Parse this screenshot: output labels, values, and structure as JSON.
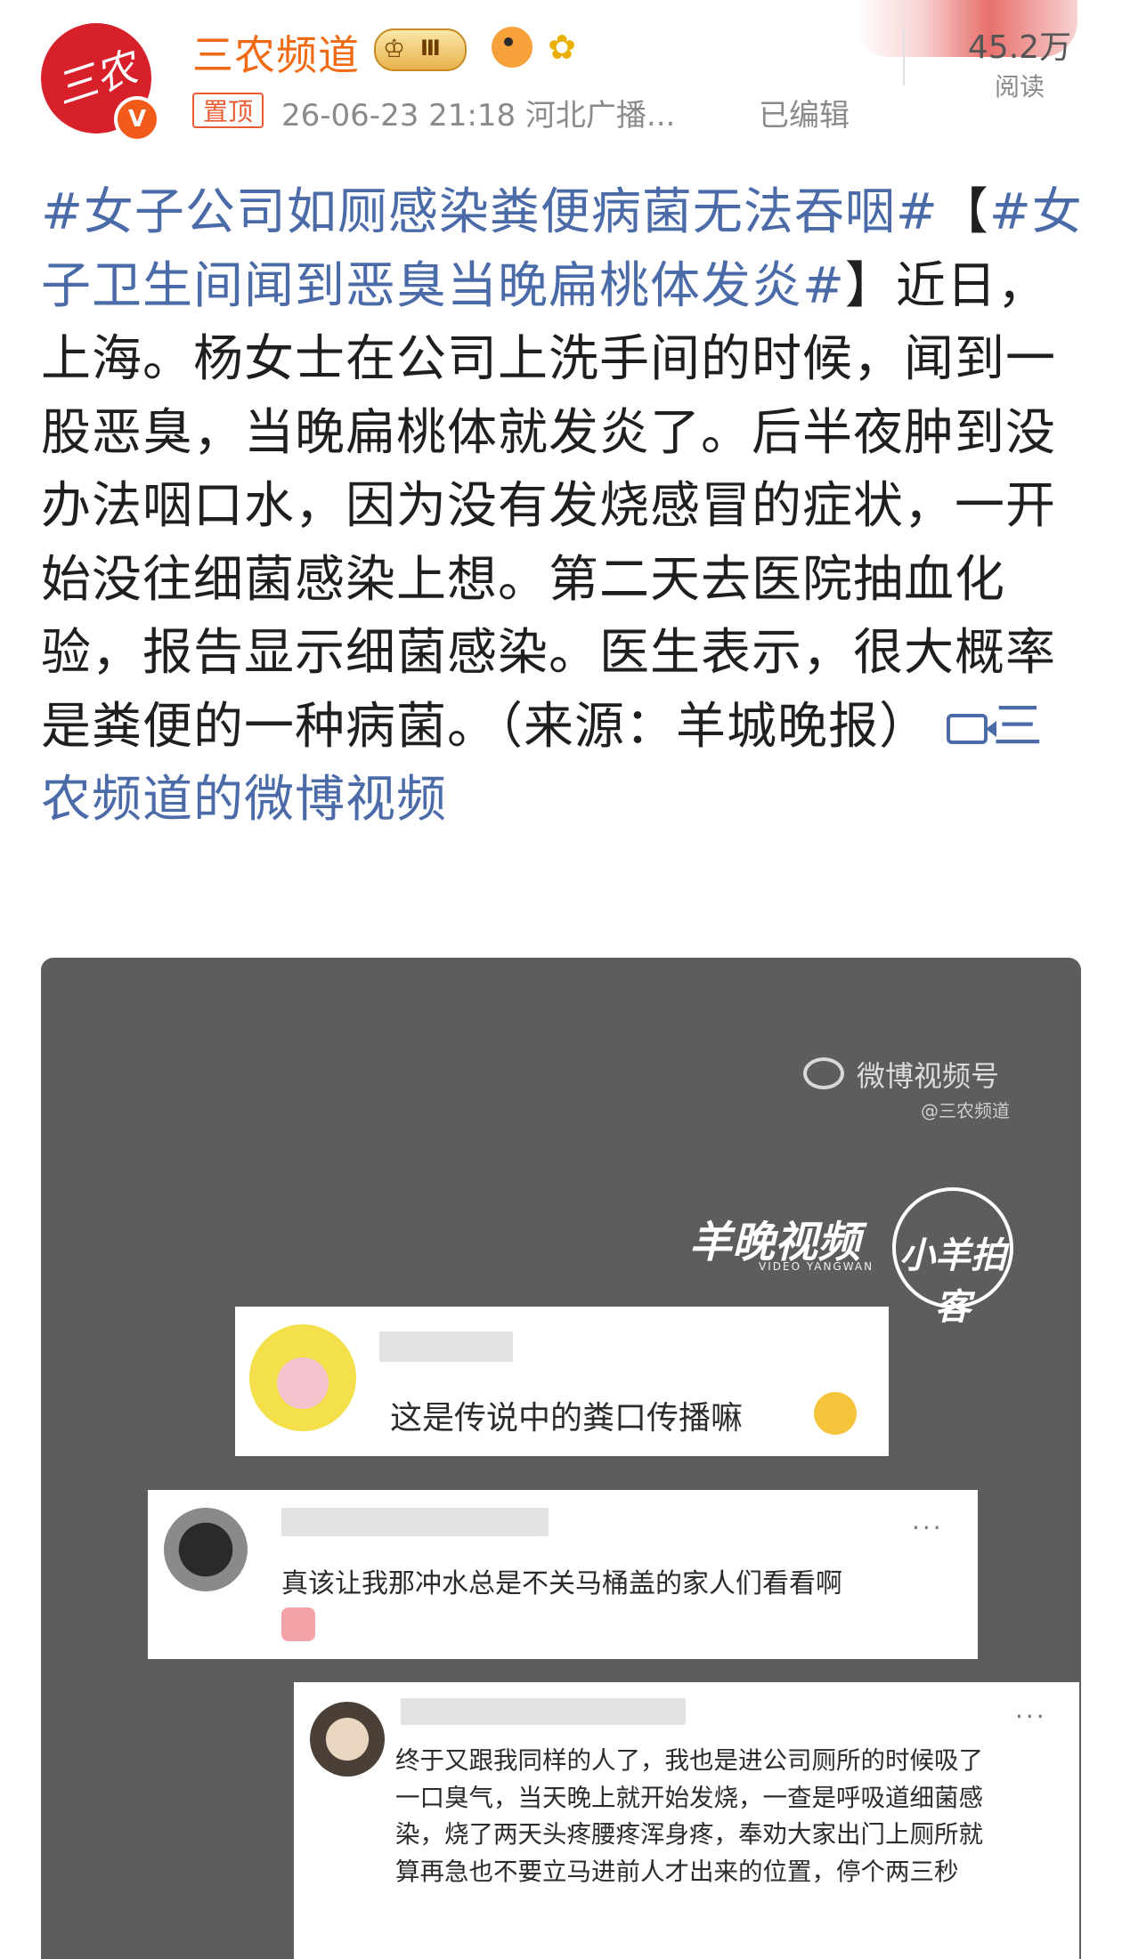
{
  "header": {
    "username": "三农频道",
    "avatar_text": "三农",
    "verified_badge": "V",
    "level_badge": "Ⅲ",
    "pinned_label": "置顶",
    "meta": "26-06-23 21:18  河北广播...",
    "edited_label": "已编辑",
    "reads_count": "45.2万",
    "reads_label": "阅读"
  },
  "post": {
    "hashtag1": "#女子公司如厕感染粪便病菌无法吞咽#",
    "bracket_open": "【",
    "hashtag2": "#女子卫生间闻到恶臭当晚扁桃体发炎#",
    "bracket_close": "】",
    "body": "近日，上海。杨女士在公司上洗手间的时候，闻到一股恶臭，当晚扁桃体就发炎了。后半夜肿到没办法咽口水，因为没有发烧感冒的症状，一开始没往细菌感染上想。第二天去医院抽血化验，报告显示细菌感染。医生表示，很大概率是粪便的一种病菌。（来源：羊城晚报）",
    "video_link": "三农频道的微博视频",
    "video_icon": "video-camera-icon"
  },
  "video": {
    "watermark_platform": "微博视频号",
    "watermark_account": "@三农频道",
    "logo1": "羊晚视频",
    "logo1_sub": "VIDEO YANGWAN",
    "logo2": "小羊拍客",
    "comments": [
      {
        "text": "这是传说中的粪口传播嘛"
      },
      {
        "text": "真该让我那冲水总是不关马桶盖的家人们看看啊",
        "more": "..."
      },
      {
        "text": "终于又跟我同样的人了，我也是进公司厕所的时候吸了一口臭气，当天晚上就开始发烧，一查是呼吸道细菌感染，烧了两天头疼腰疼浑身疼，奉劝大家出门上厕所就算再急也不要立马进前人才出来的位置，停个两三秒",
        "more": "..."
      }
    ]
  },
  "colors": {
    "username": "#f06a14",
    "link": "#4a6aa8",
    "avatar_bg": "#d8202a",
    "pin": "#ea5a32"
  }
}
